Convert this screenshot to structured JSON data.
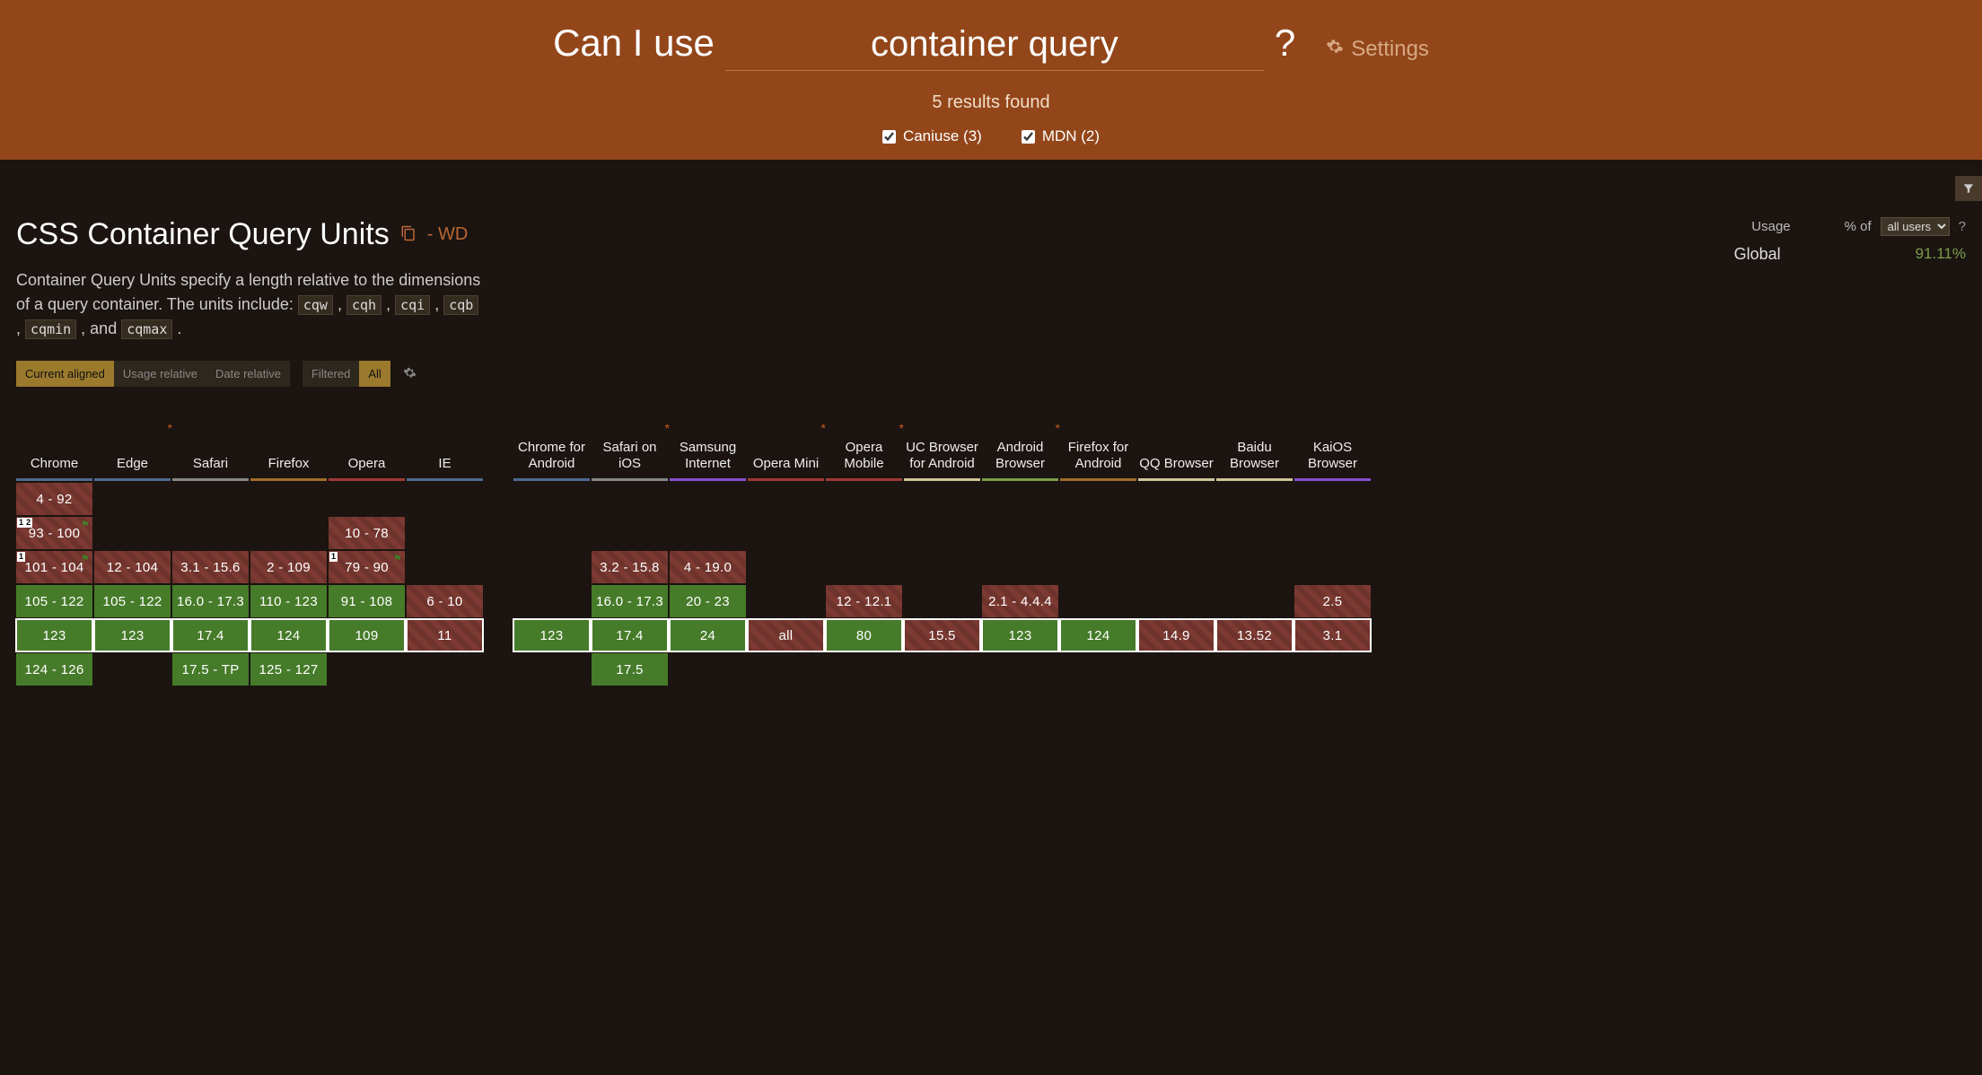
{
  "header": {
    "label": "Can I use",
    "query": "container query",
    "qmark": "?",
    "settings": "Settings",
    "results": "5 results found",
    "filters": {
      "caniuse": "Caniuse (3)",
      "mdn": "MDN (2)"
    }
  },
  "feature": {
    "title": "CSS Container Query Units",
    "status": "- WD",
    "desc_prefix": "Container Query Units specify a length relative to the dimensions of a query container. The units include: ",
    "codes": [
      "cqw",
      "cqh",
      "cqi",
      "cqb",
      "cqmin",
      "cqmax"
    ],
    "usage": {
      "label": "Usage",
      "pctof": "% of",
      "scope": "all users",
      "help": "?",
      "global_label": "Global",
      "value": "91.11%"
    },
    "view": {
      "group1": [
        "Current aligned",
        "Usage relative",
        "Date relative"
      ],
      "group2": [
        "Filtered",
        "All"
      ]
    },
    "browsers": [
      {
        "id": "chrome",
        "name": "Chrome",
        "underline": "u-chrome",
        "star": false,
        "versions": [
          {
            "t": "4 - 92",
            "c": "no"
          },
          {
            "t": "93 - 100",
            "c": "no",
            "note": "1 2",
            "flag": true
          },
          {
            "t": "101 - 104",
            "c": "no",
            "note": "1",
            "flag": true
          },
          {
            "t": "105 - 122",
            "c": "yes"
          },
          {
            "t": "123",
            "c": "yes",
            "current": true
          },
          {
            "t": "124 - 126",
            "c": "yes"
          }
        ]
      },
      {
        "id": "edge",
        "name": "Edge",
        "underline": "u-edge",
        "star": true,
        "versions": [
          {
            "c": "empty"
          },
          {
            "c": "empty"
          },
          {
            "t": "12 - 104",
            "c": "no"
          },
          {
            "t": "105 - 122",
            "c": "yes"
          },
          {
            "t": "123",
            "c": "yes",
            "current": true
          },
          {
            "c": "empty"
          }
        ]
      },
      {
        "id": "safari",
        "name": "Safari",
        "underline": "u-safari",
        "star": false,
        "versions": [
          {
            "c": "empty"
          },
          {
            "c": "empty"
          },
          {
            "t": "3.1 - 15.6",
            "c": "no"
          },
          {
            "t": "16.0 - 17.3",
            "c": "yes"
          },
          {
            "t": "17.4",
            "c": "yes",
            "current": true
          },
          {
            "t": "17.5 - TP",
            "c": "yes"
          }
        ]
      },
      {
        "id": "firefox",
        "name": "Firefox",
        "underline": "u-firefox",
        "star": false,
        "versions": [
          {
            "c": "empty"
          },
          {
            "c": "empty"
          },
          {
            "t": "2 - 109",
            "c": "no"
          },
          {
            "t": "110 - 123",
            "c": "yes"
          },
          {
            "t": "124",
            "c": "yes",
            "current": true
          },
          {
            "t": "125 - 127",
            "c": "yes"
          }
        ]
      },
      {
        "id": "opera",
        "name": "Opera",
        "underline": "u-opera",
        "star": false,
        "versions": [
          {
            "c": "empty"
          },
          {
            "t": "10 - 78",
            "c": "no"
          },
          {
            "t": "79 - 90",
            "c": "no",
            "note": "1",
            "flag": true
          },
          {
            "t": "91 - 108",
            "c": "yes"
          },
          {
            "t": "109",
            "c": "yes",
            "current": true
          },
          {
            "c": "empty"
          }
        ]
      },
      {
        "id": "ie",
        "name": "IE",
        "underline": "u-ie",
        "star": false,
        "versions": [
          {
            "c": "empty"
          },
          {
            "c": "empty"
          },
          {
            "c": "empty"
          },
          {
            "t": "6 - 10",
            "c": "no"
          },
          {
            "t": "11",
            "c": "no",
            "current": true
          },
          {
            "c": "empty"
          }
        ]
      },
      {
        "id": "spacer",
        "spacer": true
      },
      {
        "id": "chrome_android",
        "name": "Chrome for Android",
        "underline": "u-chrome_android",
        "star": false,
        "versions": [
          {
            "c": "empty"
          },
          {
            "c": "empty"
          },
          {
            "c": "empty"
          },
          {
            "c": "empty"
          },
          {
            "t": "123",
            "c": "yes",
            "current": true
          },
          {
            "c": "empty"
          }
        ]
      },
      {
        "id": "safari_ios",
        "name": "Safari on iOS",
        "underline": "u-safari_ios",
        "star": true,
        "versions": [
          {
            "c": "empty"
          },
          {
            "c": "empty"
          },
          {
            "t": "3.2 - 15.8",
            "c": "no"
          },
          {
            "t": "16.0 - 17.3",
            "c": "yes"
          },
          {
            "t": "17.4",
            "c": "yes",
            "current": true
          },
          {
            "t": "17.5",
            "c": "yes"
          }
        ]
      },
      {
        "id": "samsung",
        "name": "Samsung Internet",
        "underline": "u-samsung",
        "star": false,
        "versions": [
          {
            "c": "empty"
          },
          {
            "c": "empty"
          },
          {
            "t": "4 - 19.0",
            "c": "no"
          },
          {
            "t": "20 - 23",
            "c": "yes"
          },
          {
            "t": "24",
            "c": "yes",
            "current": true
          },
          {
            "c": "empty"
          }
        ]
      },
      {
        "id": "opmini",
        "name": "Opera Mini",
        "underline": "u-opmini",
        "star": true,
        "versions": [
          {
            "c": "empty"
          },
          {
            "c": "empty"
          },
          {
            "c": "empty"
          },
          {
            "c": "empty"
          },
          {
            "t": "all",
            "c": "no",
            "current": true
          },
          {
            "c": "empty"
          }
        ]
      },
      {
        "id": "opmobile",
        "name": "Opera Mobile",
        "underline": "u-opmobile",
        "star": true,
        "versions": [
          {
            "c": "empty"
          },
          {
            "c": "empty"
          },
          {
            "c": "empty"
          },
          {
            "t": "12 - 12.1",
            "c": "no"
          },
          {
            "t": "80",
            "c": "yes",
            "current": true
          },
          {
            "c": "empty"
          }
        ]
      },
      {
        "id": "uc",
        "name": "UC Browser for Android",
        "underline": "u-uc",
        "star": false,
        "versions": [
          {
            "c": "empty"
          },
          {
            "c": "empty"
          },
          {
            "c": "empty"
          },
          {
            "c": "empty"
          },
          {
            "t": "15.5",
            "c": "no",
            "current": true
          },
          {
            "c": "empty"
          }
        ]
      },
      {
        "id": "android",
        "name": "Android Browser",
        "underline": "u-android",
        "star": true,
        "versions": [
          {
            "c": "empty"
          },
          {
            "c": "empty"
          },
          {
            "c": "empty"
          },
          {
            "t": "2.1 - 4.4.4",
            "c": "no"
          },
          {
            "t": "123",
            "c": "yes",
            "current": true
          },
          {
            "c": "empty"
          }
        ]
      },
      {
        "id": "ff_android",
        "name": "Firefox for Android",
        "underline": "u-ff_android",
        "star": false,
        "versions": [
          {
            "c": "empty"
          },
          {
            "c": "empty"
          },
          {
            "c": "empty"
          },
          {
            "c": "empty"
          },
          {
            "t": "124",
            "c": "yes",
            "current": true
          },
          {
            "c": "empty"
          }
        ]
      },
      {
        "id": "qq",
        "name": "QQ Browser",
        "underline": "u-qq",
        "star": false,
        "versions": [
          {
            "c": "empty"
          },
          {
            "c": "empty"
          },
          {
            "c": "empty"
          },
          {
            "c": "empty"
          },
          {
            "t": "14.9",
            "c": "no",
            "current": true
          },
          {
            "c": "empty"
          }
        ]
      },
      {
        "id": "baidu",
        "name": "Baidu Browser",
        "underline": "u-baidu",
        "star": false,
        "versions": [
          {
            "c": "empty"
          },
          {
            "c": "empty"
          },
          {
            "c": "empty"
          },
          {
            "c": "empty"
          },
          {
            "t": "13.52",
            "c": "no",
            "current": true
          },
          {
            "c": "empty"
          }
        ]
      },
      {
        "id": "kaios",
        "name": "KaiOS Browser",
        "underline": "u-kaios",
        "star": false,
        "versions": [
          {
            "c": "empty"
          },
          {
            "c": "empty"
          },
          {
            "c": "empty"
          },
          {
            "t": "2.5",
            "c": "no"
          },
          {
            "t": "3.1",
            "c": "no",
            "current": true
          },
          {
            "c": "empty"
          }
        ]
      }
    ]
  }
}
